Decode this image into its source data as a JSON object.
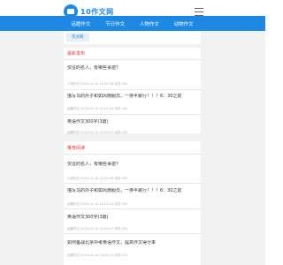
{
  "header": {
    "logo_text": "10作文网"
  },
  "nav": {
    "items": [
      "话题作文",
      "节日作文",
      "人物作文",
      "动物作文"
    ]
  },
  "subnav": {
    "tab": "作文网"
  },
  "sections": [
    {
      "title": "最新发布",
      "items": [
        {
          "title": "仅征的名人，有哪些事迹?",
          "meta": "人物作文 2023-01-14 10:02:36 浏览:302"
        },
        {
          "title": "描写乌的外子和如风雨服员，一排半跳行！！！6：30之前",
          "meta": "话题作文 2023-01-14 10:02:24 浏览:302"
        },
        {
          "title": "英语作文300字(3篇)",
          "meta": "话题作文 2023-01-14 10:00:17 浏览:255"
        }
      ]
    },
    {
      "title": "推荐阅读",
      "items": [
        {
          "title": "仅征的名人，有哪些事迹?",
          "meta": "人物作文 2023-01-14 10:02:36 浏览:302"
        },
        {
          "title": "描写乌的外子和如风雨服员，一排半跳行！！！6：30之前",
          "meta": "话题作文 2023-01-14 10:02:24 浏览:302"
        },
        {
          "title": "英语作文300字(3篇)",
          "meta": "话题作文 2023-01-14 10:00:17 浏览:255"
        },
        {
          "title": "如何备战北京中考英语作文，提高作文得分率",
          "meta": "话题作文 2023-01-14 10:00:12 浏览:221"
        }
      ]
    }
  ],
  "colors": {
    "brand": "#1e88e5",
    "section_title": "#e53935"
  }
}
